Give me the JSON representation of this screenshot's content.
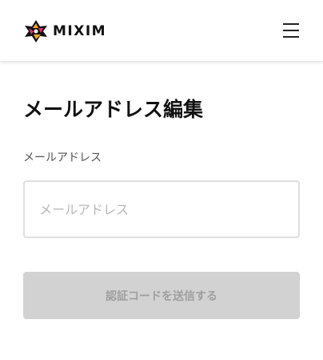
{
  "header": {
    "logo_text": "MIXIM",
    "logo_icon": "mixim-logo-mark-icon",
    "menu_icon": "hamburger-menu-icon"
  },
  "main": {
    "title": "メールアドレス編集",
    "email": {
      "label": "メールアドレス",
      "value": "",
      "placeholder": "メールアドレス"
    },
    "submit_label": "認証コードを送信する",
    "submit_disabled": true
  },
  "colors": {
    "logo_orange": "#f5a623",
    "logo_magenta": "#e0306e",
    "button_disabled_bg": "#d2d2d2",
    "button_disabled_text": "#9f9f9f"
  }
}
